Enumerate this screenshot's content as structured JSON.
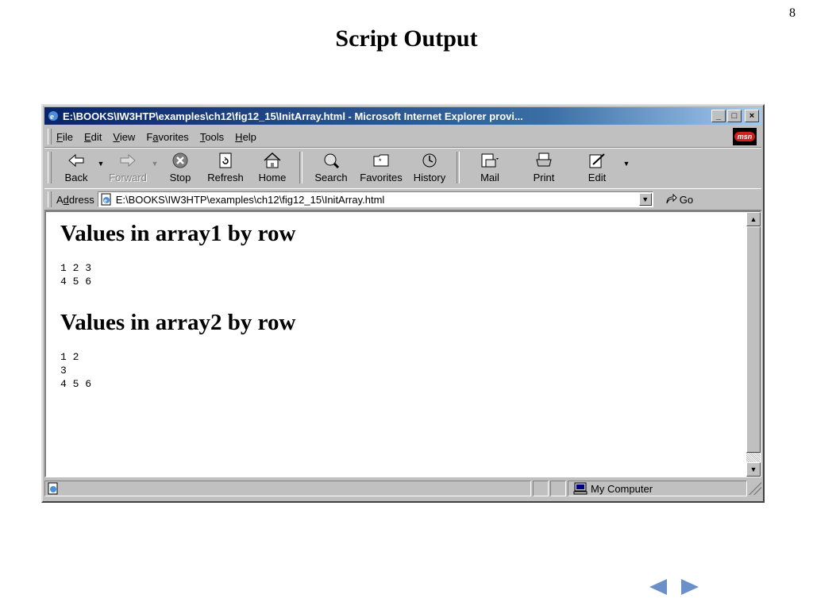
{
  "slide": {
    "number": "8",
    "title": "Script Output"
  },
  "window": {
    "title": "E:\\BOOKS\\IW3HTP\\examples\\ch12\\fig12_15\\InitArray.html - Microsoft Internet Explorer provi...",
    "minimize": "_",
    "maximize": "□",
    "close": "×"
  },
  "menu": {
    "items": [
      {
        "pre": "",
        "u": "F",
        "post": "ile"
      },
      {
        "pre": "",
        "u": "E",
        "post": "dit"
      },
      {
        "pre": "",
        "u": "V",
        "post": "iew"
      },
      {
        "pre": "F",
        "u": "a",
        "post": "vorites"
      },
      {
        "pre": "",
        "u": "T",
        "post": "ools"
      },
      {
        "pre": "",
        "u": "H",
        "post": "elp"
      }
    ],
    "logo": "msn"
  },
  "toolbar": {
    "back": "Back",
    "forward": "Forward",
    "stop": "Stop",
    "refresh": "Refresh",
    "home": "Home",
    "search": "Search",
    "favorites": "Favorites",
    "history": "History",
    "mail": "Mail",
    "print": "Print",
    "edit": "Edit"
  },
  "address": {
    "label_pre": "A",
    "label_u": "d",
    "label_post": "dress",
    "value": "E:\\BOOKS\\IW3HTP\\examples\\ch12\\fig12_15\\InitArray.html",
    "go": "Go"
  },
  "content": {
    "heading1": "Values in array1 by row",
    "array1_rows": "1 2 3\n4 5 6",
    "heading2": "Values in array2 by row",
    "array2_rows": "1 2\n3\n4 5 6"
  },
  "status": {
    "zone": "My Computer"
  },
  "icons": {
    "ie": "ie-icon",
    "back": "back-arrow-icon",
    "forward": "forward-arrow-icon",
    "stop": "stop-icon",
    "refresh": "refresh-icon",
    "home": "home-icon",
    "search": "search-icon",
    "favorites": "favorites-icon",
    "history": "history-icon",
    "mail": "mail-icon",
    "print": "print-icon",
    "edit": "edit-icon",
    "computer": "computer-icon",
    "nav_prev": "previous-slide-icon",
    "nav_next": "next-slide-icon"
  },
  "colors": {
    "titlebar": "#0a246a",
    "nav_arrow": "#6b8fc7"
  }
}
